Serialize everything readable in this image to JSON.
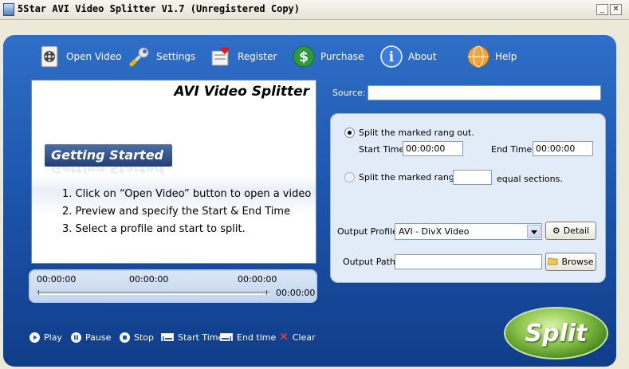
{
  "window": {
    "title": "5Star AVI Video Splitter V1.7 (Unregistered Copy)",
    "minimize": "_",
    "close": "✕"
  },
  "toolbar": {
    "open_video": "Open Video",
    "settings": "Settings",
    "register": "Register",
    "purchase": "Purchase",
    "about": "About",
    "help": "Help"
  },
  "preview": {
    "title": "AVI Video Splitter",
    "banner": "Getting Started",
    "steps": [
      "1. Click on “Open Video” button to open a video",
      "2. Preview and specify the Start & End Time",
      "3. Select a profile and start to split."
    ]
  },
  "timeline": {
    "start": "00:00:00",
    "middle": "00:00:00",
    "end_marker": "00:00:00",
    "total": "00:00:00"
  },
  "source": {
    "label": "Source:",
    "value": ""
  },
  "split_options": {
    "mode_marked": "Split the marked rang out.",
    "start_time_label": "Start Time:",
    "start_time": "00:00:00",
    "end_time_label": "End Time:",
    "end_time": "00:00:00",
    "mode_equal": "Split the marked rang to",
    "sections_value": "",
    "sections_suffix": "equal sections.",
    "selected_mode": "marked"
  },
  "output": {
    "profile_label": "Output Profile:",
    "profile_value": "AVI - DivX Video",
    "detail_button": "Detail",
    "path_label": "Output Path:",
    "path_value": "",
    "browse_button": "Browse"
  },
  "controls": {
    "play": "Play",
    "pause": "Pause",
    "stop": "Stop",
    "start_time": "Start Time",
    "end_time": "End time",
    "clear": "Clear"
  },
  "split_button": "Split"
}
